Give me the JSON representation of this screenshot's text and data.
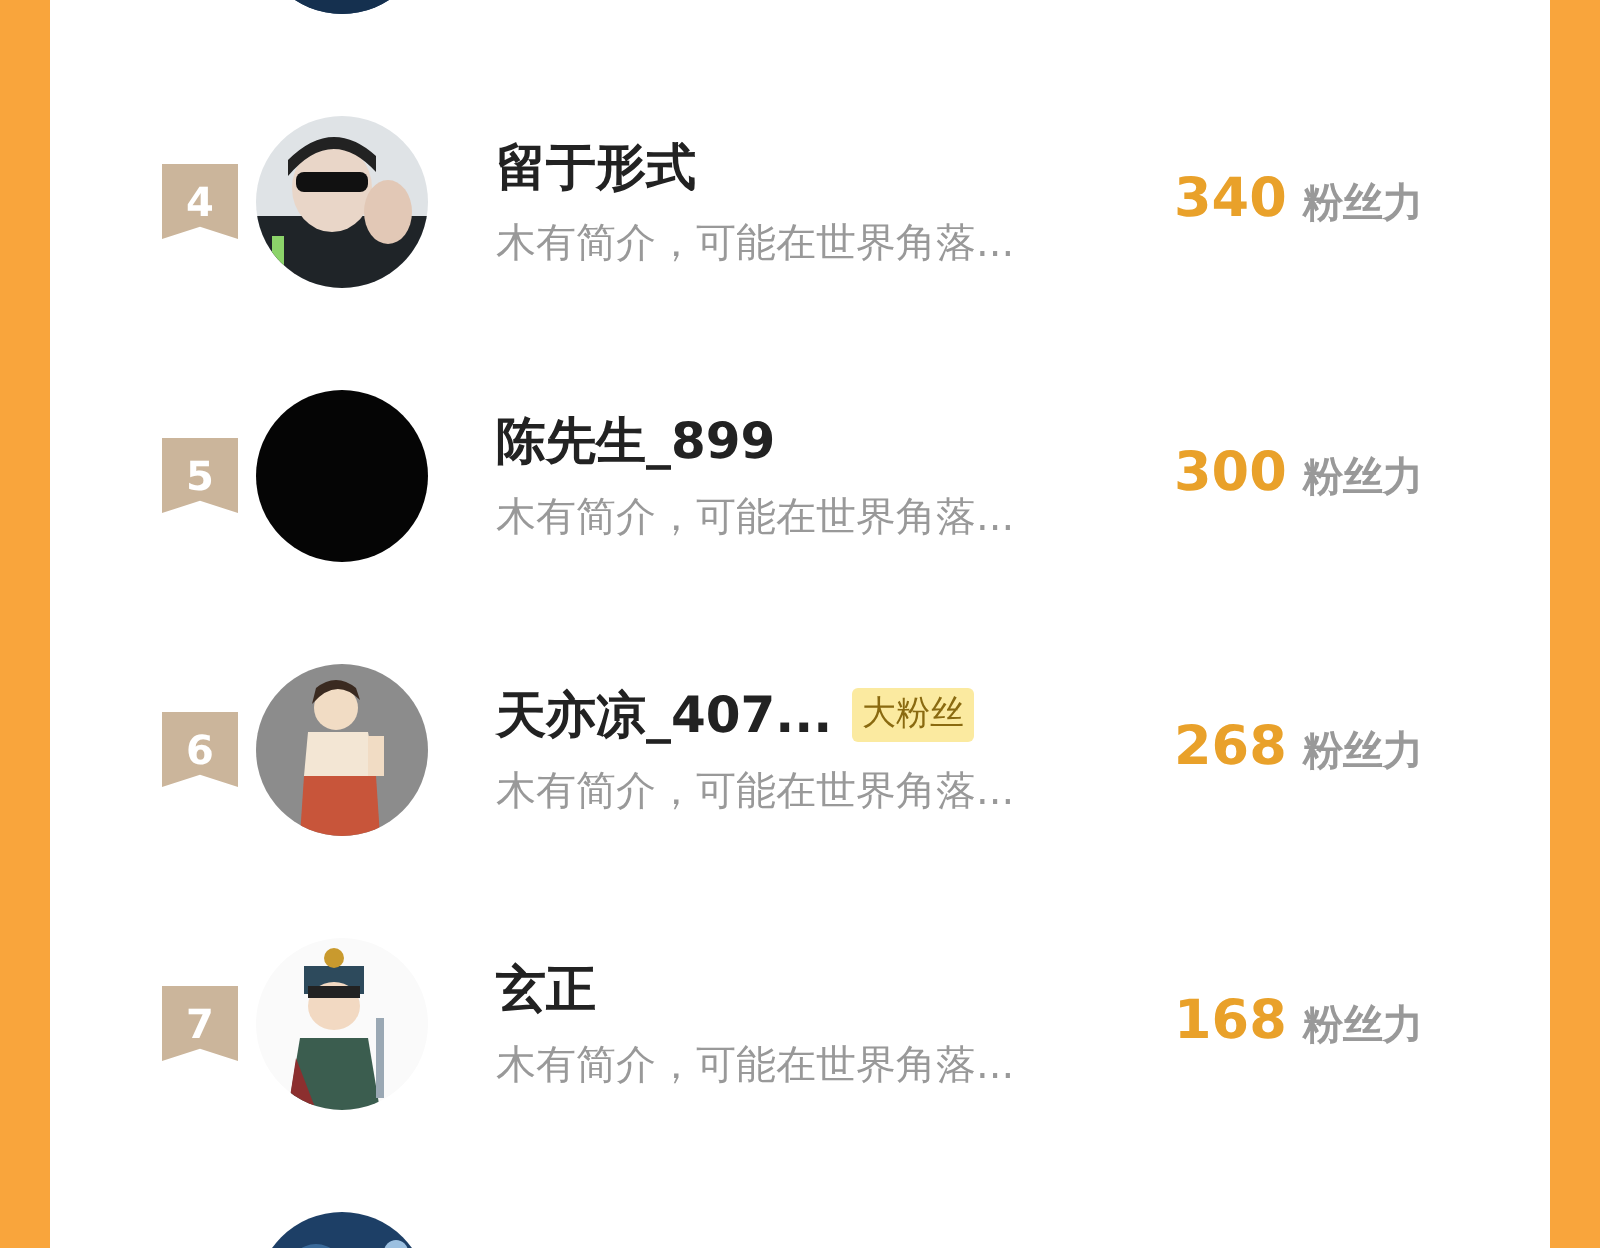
{
  "users": [
    {
      "kind": "cut"
    },
    {
      "kind": "full",
      "rank": "4",
      "name": "留于形式",
      "bio": "木有简介，可能在世界角落...",
      "fans": "340",
      "fans_label": "粉丝力"
    },
    {
      "kind": "full",
      "rank": "5",
      "name": "陈先生_899",
      "bio": "木有简介，可能在世界角落...",
      "fans": "300",
      "fans_label": "粉丝力"
    },
    {
      "kind": "full",
      "rank": "6",
      "name": "天亦凉_407...",
      "tag": "大粉丝",
      "bio": "木有简介，可能在世界角落...",
      "fans": "268",
      "fans_label": "粉丝力"
    },
    {
      "kind": "full",
      "rank": "7",
      "name": "玄正",
      "bio": "木有简介，可能在世界角落...",
      "fans": "168",
      "fans_label": "粉丝力"
    },
    {
      "kind": "cut"
    }
  ]
}
